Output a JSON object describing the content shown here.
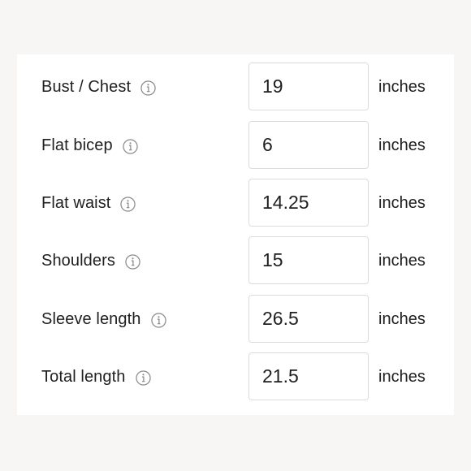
{
  "measurements": [
    {
      "label": "Bust / Chest",
      "value": "19",
      "unit": "inches"
    },
    {
      "label": "Flat bicep",
      "value": "6",
      "unit": "inches"
    },
    {
      "label": "Flat waist",
      "value": "14.25",
      "unit": "inches"
    },
    {
      "label": "Shoulders",
      "value": "15",
      "unit": "inches"
    },
    {
      "label": "Sleeve length",
      "value": "26.5",
      "unit": "inches"
    },
    {
      "label": "Total length",
      "value": "21.5",
      "unit": "inches"
    }
  ],
  "icons": {
    "info": "info-icon"
  },
  "colors": {
    "text": "#1f1f1f",
    "border": "#dcdcdc",
    "background": "#f7f6f4",
    "card": "#ffffff",
    "icon": "#8a8a8a"
  }
}
